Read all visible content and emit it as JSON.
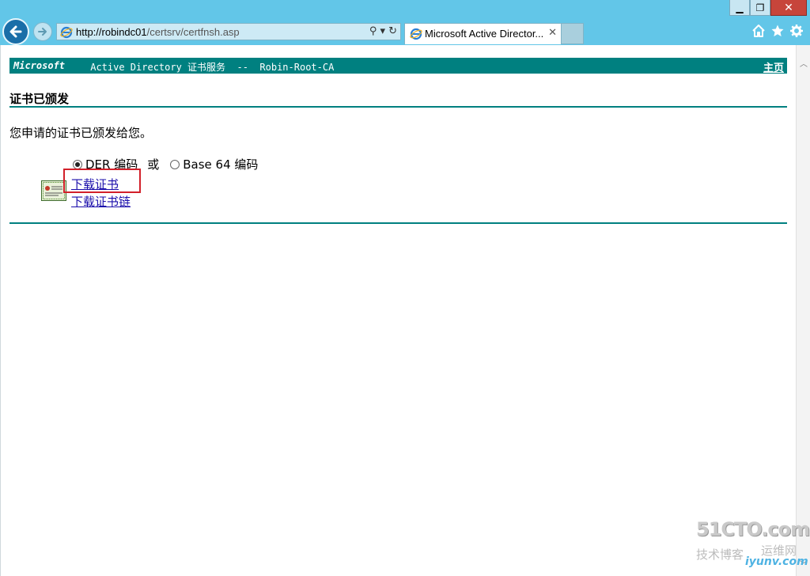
{
  "window": {
    "min_glyph": "▁",
    "max_glyph": "❐",
    "close_glyph": "✕"
  },
  "addressbar": {
    "url_domain": "http://robindc01",
    "url_path": "/certsrv/certfnsh.asp",
    "search_glyph": "⚲ ▾",
    "refresh_glyph": "↻"
  },
  "tab": {
    "title": "Microsoft Active Director...",
    "close_glyph": "✕"
  },
  "toolbar": {
    "home_icon": "home-icon",
    "favorites_icon": "star-icon",
    "tools_icon": "gear-icon"
  },
  "page": {
    "header_brand": "Microsoft",
    "header_rest": " Active Directory 证书服务  --  Robin-Root-CA",
    "home_link": "主页",
    "title": "证书已颁发",
    "message": "您申请的证书已颁发给您。",
    "encoding": {
      "option_der": "DER 编码",
      "or_label": "或",
      "option_base64": "Base 64 编码",
      "selected": "DER"
    },
    "download_cert": "下载证书",
    "download_chain": "下载证书链"
  },
  "watermark": {
    "top": "51CTO.com",
    "left": "技术博客",
    "right": "运维网",
    "url": "iyunv.com"
  },
  "colors": {
    "accent_teal": "#008080",
    "link": "#1a0dab",
    "highlight": "#d2202a",
    "chrome": "#62c6e8"
  }
}
